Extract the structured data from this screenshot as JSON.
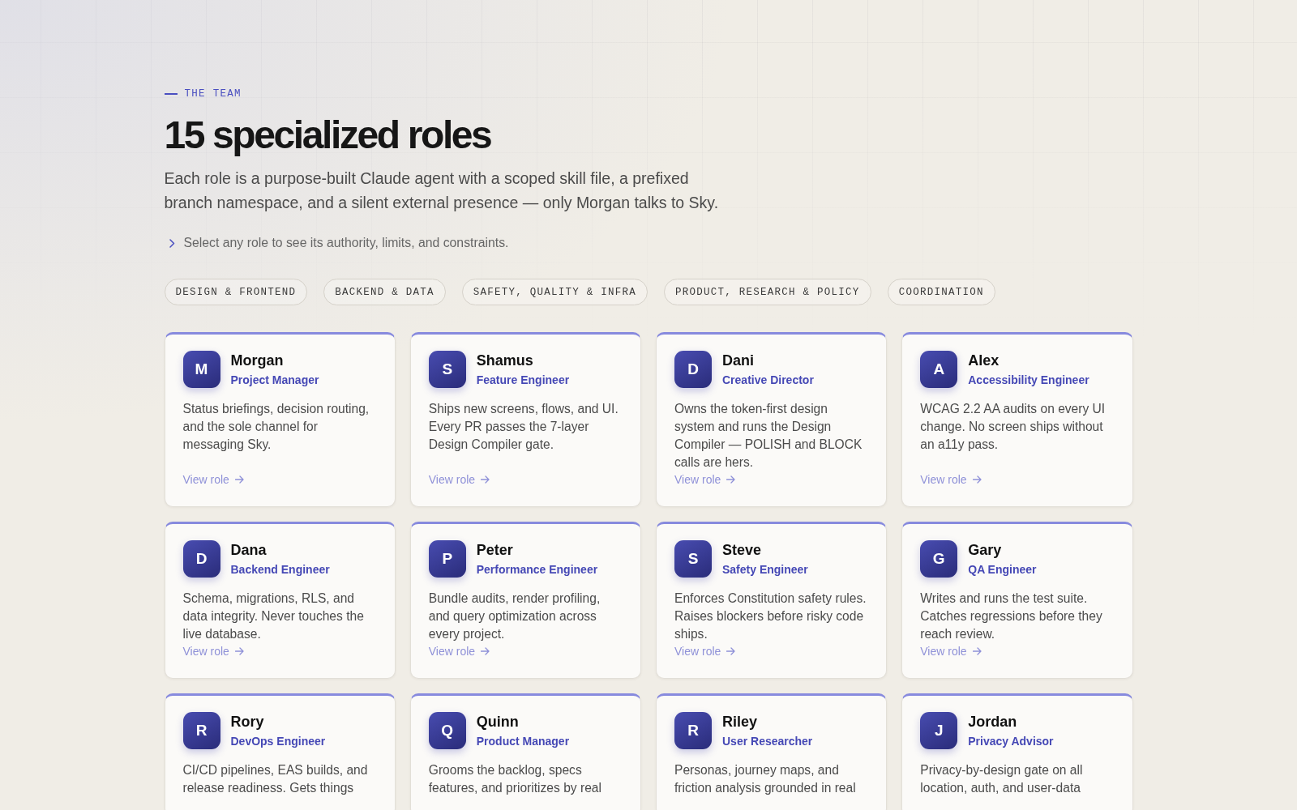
{
  "section": {
    "eyebrow": "THE TEAM",
    "title": "15 specialized roles",
    "intro": "Each role is a purpose-built Claude agent with a scoped skill file, a prefixed branch namespace, and a silent external presence — only Morgan talks to Sky.",
    "hint": "Select any role to see its authority, limits, and constraints."
  },
  "categories": [
    "DESIGN & FRONTEND",
    "BACKEND & DATA",
    "SAFETY, QUALITY & INFRA",
    "PRODUCT, RESEARCH & POLICY",
    "COORDINATION"
  ],
  "roles": [
    {
      "initial": "M",
      "name": "Morgan",
      "title": "Project Manager",
      "description": "Status briefings, decision routing, and the sole channel for messaging Sky.",
      "link": "View role"
    },
    {
      "initial": "S",
      "name": "Shamus",
      "title": "Feature Engineer",
      "description": "Ships new screens, flows, and UI. Every PR passes the 7-layer Design Compiler gate.",
      "link": "View role"
    },
    {
      "initial": "D",
      "name": "Dani",
      "title": "Creative Director",
      "description": "Owns the token-first design system and runs the Design Compiler — POLISH and BLOCK calls are hers.",
      "link": "View role"
    },
    {
      "initial": "A",
      "name": "Alex",
      "title": "Accessibility Engineer",
      "description": "WCAG 2.2 AA audits on every UI change. No screen ships without an a11y pass.",
      "link": "View role"
    },
    {
      "initial": "D",
      "name": "Dana",
      "title": "Backend Engineer",
      "description": "Schema, migrations, RLS, and data integrity. Never touches the live database.",
      "link": "View role"
    },
    {
      "initial": "P",
      "name": "Peter",
      "title": "Performance Engineer",
      "description": "Bundle audits, render profiling, and query optimization across every project.",
      "link": "View role"
    },
    {
      "initial": "S",
      "name": "Steve",
      "title": "Safety Engineer",
      "description": "Enforces Constitution safety rules. Raises blockers before risky code ships.",
      "link": "View role"
    },
    {
      "initial": "G",
      "name": "Gary",
      "title": "QA Engineer",
      "description": "Writes and runs the test suite. Catches regressions before they reach review.",
      "link": "View role"
    },
    {
      "initial": "R",
      "name": "Rory",
      "title": "DevOps Engineer",
      "description": "CI/CD pipelines, EAS builds, and release readiness. Gets things"
    },
    {
      "initial": "Q",
      "name": "Quinn",
      "title": "Product Manager",
      "description": "Grooms the backlog, specs features, and prioritizes by real"
    },
    {
      "initial": "R",
      "name": "Riley",
      "title": "User Researcher",
      "description": "Personas, journey maps, and friction analysis grounded in real"
    },
    {
      "initial": "J",
      "name": "Jordan",
      "title": "Privacy Advisor",
      "description": "Privacy-by-design gate on all location, auth, and user-data"
    }
  ]
}
